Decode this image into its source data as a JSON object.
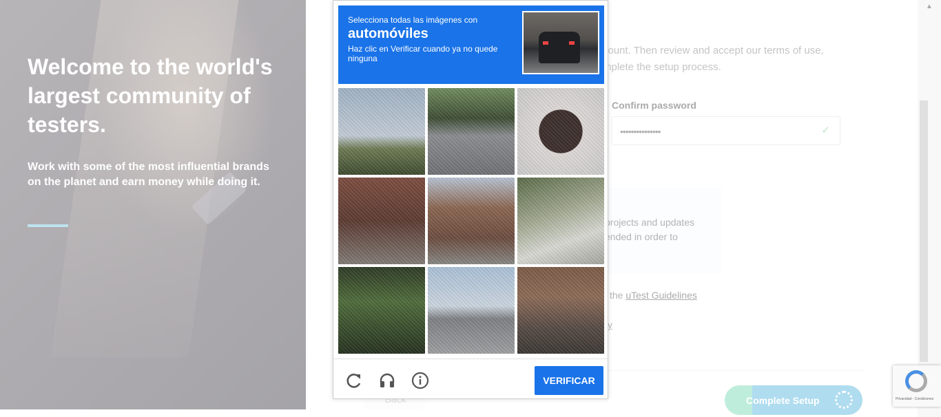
{
  "hero": {
    "title": "Welcome to the world's largest community of testers.",
    "subtitle": "Work with some of the most influential brands on the planet and earn money while doing it."
  },
  "form": {
    "intro_line1": "count. Then review and accept our terms of use,",
    "intro_line2": "mplete the setup process.",
    "confirm_password_label": "Confirm password",
    "confirm_password_value": "•••••••••••••••",
    "confirm_check": "✓",
    "info_line1": "projects and updates",
    "info_line2": "ended in order to",
    "guidelines_prefix": "the ",
    "guidelines_link": "uTest Guidelines",
    "y_fragment": "y",
    "back_label": "Back",
    "complete_label": "Complete Setup"
  },
  "recaptcha": {
    "instruction_line1": "Selecciona todas las imágenes con",
    "target": "automóviles",
    "instruction_line3": "Haz clic en Verificar cuando ya no quede ninguna",
    "verify_label": "VERIFICAR",
    "icons": [
      "reload-icon",
      "audio-icon",
      "info-icon"
    ],
    "tile_count": 9,
    "badge_text": "Privacidad - Condiciones"
  },
  "colors": {
    "recaptcha_blue": "#1a73e8",
    "hero_accent": "#7cc6de",
    "complete_green": "#7fdab8",
    "complete_blue": "#5fb9df"
  }
}
